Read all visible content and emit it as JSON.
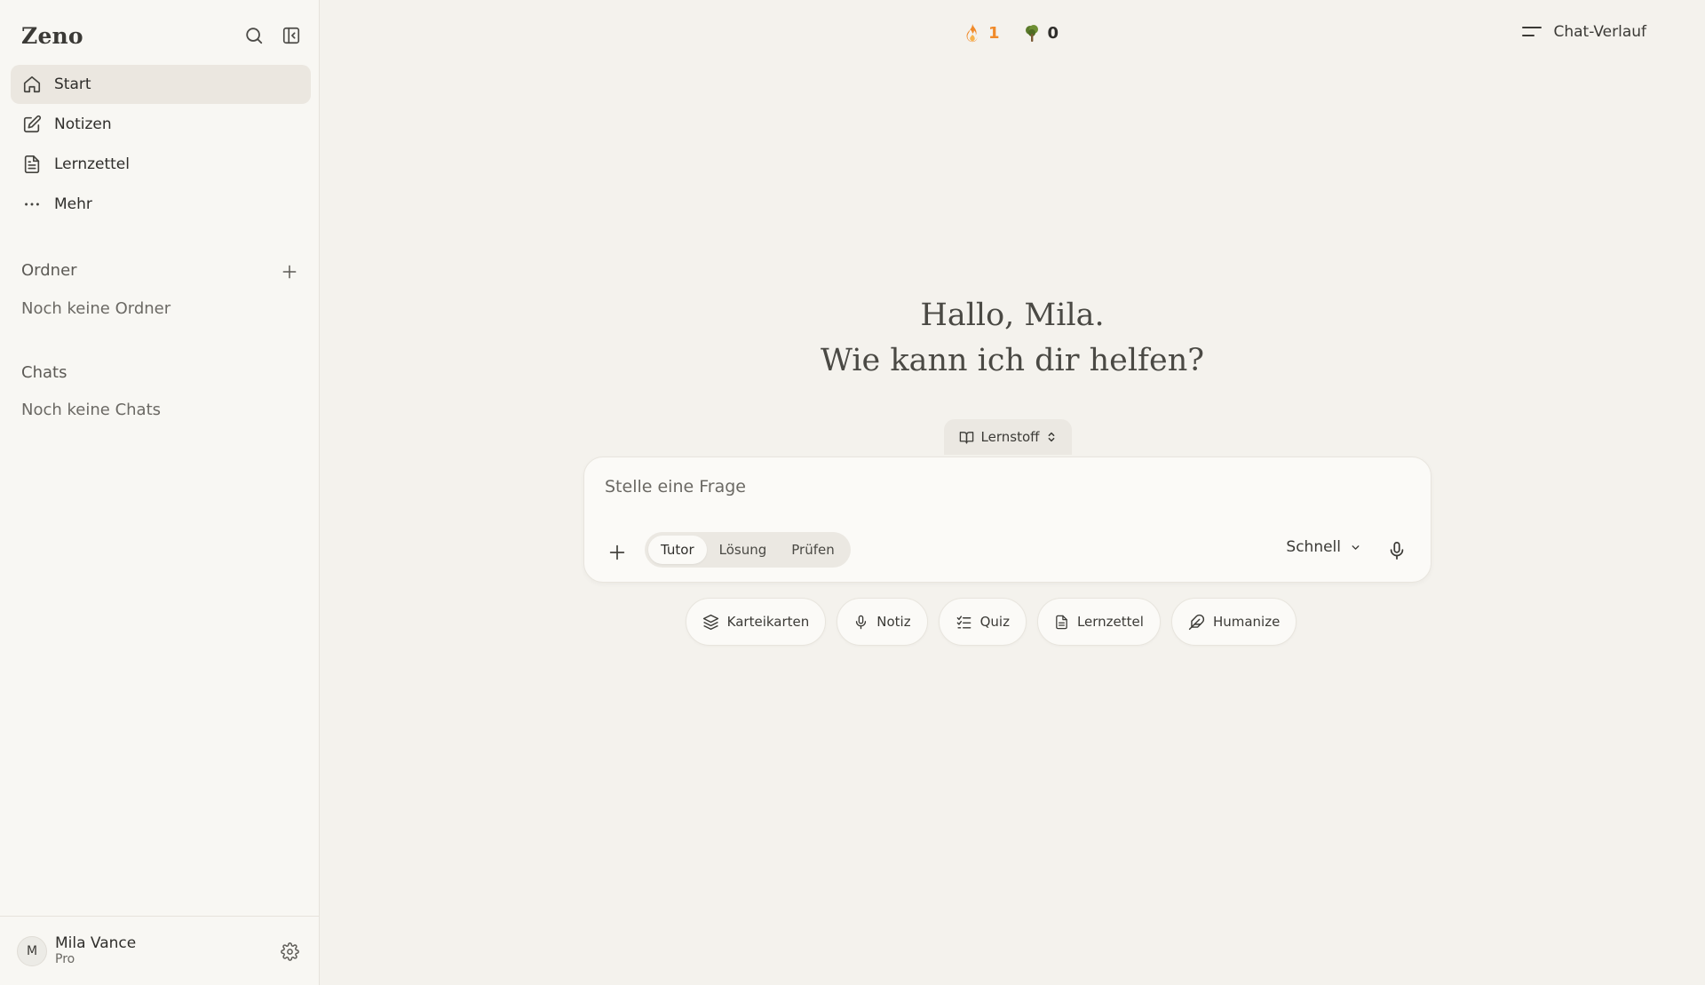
{
  "sidebar": {
    "brand": "Zeno",
    "nav": [
      {
        "label": "Start",
        "icon": "home-icon"
      },
      {
        "label": "Notizen",
        "icon": "edit-icon"
      },
      {
        "label": "Lernzettel",
        "icon": "document-icon"
      },
      {
        "label": "Mehr",
        "icon": "more-icon"
      }
    ],
    "folders": {
      "title": "Ordner",
      "empty": "Noch keine Ordner"
    },
    "chats": {
      "title": "Chats",
      "empty": "Noch keine Chats"
    },
    "user": {
      "initial": "M",
      "name": "Mila Vance",
      "plan": "Pro"
    }
  },
  "topbar": {
    "streak": "1",
    "trees": "0",
    "history_label": "Chat-Verlauf"
  },
  "main": {
    "greeting_line1": "Hallo, Mila.",
    "greeting_line2": "Wie kann ich dir helfen?",
    "source_selector": "Lernstoff",
    "composer": {
      "placeholder": "Stelle eine Frage",
      "value": "",
      "modes": [
        "Tutor",
        "Lösung",
        "Prüfen"
      ],
      "active_mode": "Tutor",
      "speed": "Schnell"
    },
    "actions": [
      {
        "label": "Karteikarten",
        "icon": "layers-icon"
      },
      {
        "label": "Notiz",
        "icon": "microphone-icon"
      },
      {
        "label": "Quiz",
        "icon": "checklist-icon"
      },
      {
        "label": "Lernzettel",
        "icon": "document-icon"
      },
      {
        "label": "Humanize",
        "icon": "feather-icon"
      }
    ]
  },
  "colors": {
    "background": "#f4f2ed",
    "sidebar": "#f8f7f3",
    "active_nav": "#ebe7e0",
    "streak_orange": "#f08a2a",
    "tree_green": "#5a7a2a"
  }
}
